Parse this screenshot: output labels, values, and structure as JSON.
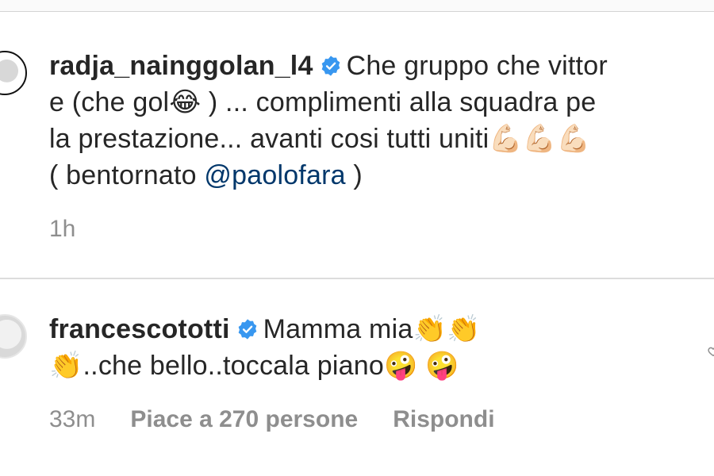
{
  "comments": [
    {
      "username": "radja_nainggolan_l4",
      "lines": [
        "Che gruppo che vittor",
        "e (che gol😂 ) ... complimenti alla squadra pe",
        "la prestazione... avanti cosi tutti uniti💪🏻💪🏻💪🏻",
        "( bentornato "
      ],
      "mention": "@paolofara",
      "line4_end": " )",
      "time": "1h"
    },
    {
      "username": "francescototti",
      "lines": [
        "Mamma mia👏👏",
        "👏..che bello..toccala piano🤪 🤪"
      ],
      "time": "33m",
      "likes": "Piace a 270 persone",
      "reply": "Rispondi"
    }
  ],
  "icons": {
    "verified": "verified-badge-icon",
    "like": "heart-icon"
  },
  "colors": {
    "text": "#262626",
    "meta": "#8e8e8e",
    "mention": "#00376b",
    "verified": "#3897f0"
  }
}
